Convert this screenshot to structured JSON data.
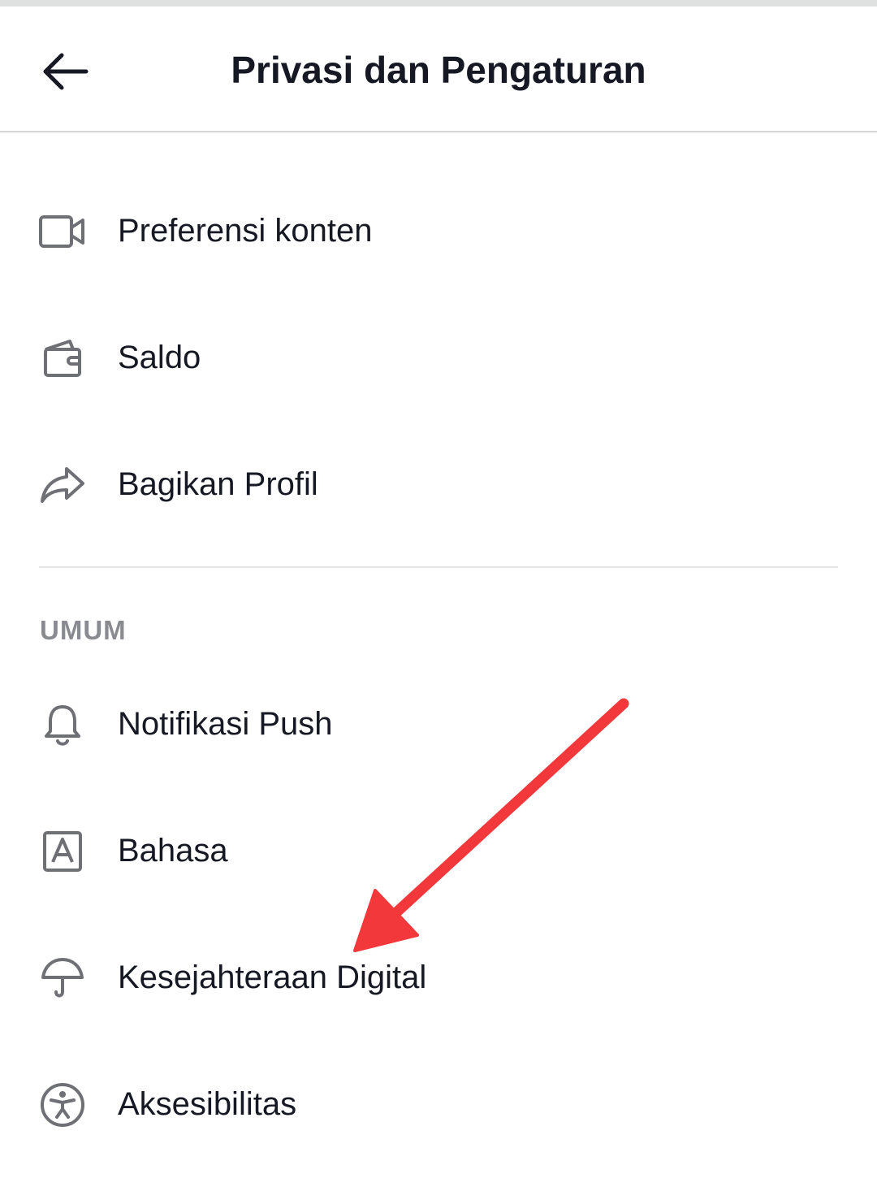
{
  "header": {
    "title": "Privasi dan Pengaturan",
    "back_icon": "arrow-left-icon"
  },
  "items_top": [
    {
      "label": "Preferensi konten",
      "icon": "video-camera-icon"
    },
    {
      "label": "Saldo",
      "icon": "wallet-icon"
    },
    {
      "label": "Bagikan Profil",
      "icon": "share-icon"
    }
  ],
  "general": {
    "section_title": "UMUM",
    "items": [
      {
        "label": "Notifikasi Push",
        "icon": "bell-icon"
      },
      {
        "label": "Bahasa",
        "icon": "language-icon"
      },
      {
        "label": "Kesejahteraan Digital",
        "icon": "umbrella-icon"
      },
      {
        "label": "Aksesibilitas",
        "icon": "accessibility-icon"
      }
    ]
  },
  "colors": {
    "text": "#161823",
    "icon": "#6f7075",
    "section_header": "#8a8b91",
    "annotation_arrow": "#f2383a"
  }
}
